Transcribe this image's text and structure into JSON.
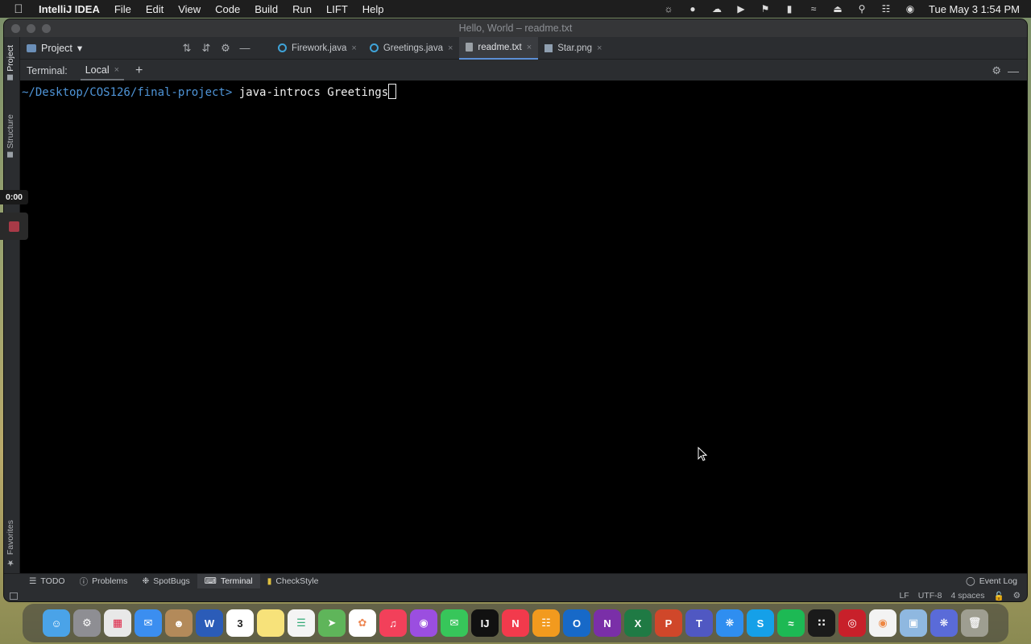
{
  "menubar": {
    "app_name": "IntelliJ IDEA",
    "items": [
      "File",
      "Edit",
      "View",
      "Code",
      "Build",
      "Run",
      "LIFT",
      "Help"
    ],
    "clock": "Tue May 3  1:54 PM"
  },
  "window": {
    "title": "Hello, World – readme.txt"
  },
  "left_strip": {
    "project_label": "Project",
    "structure_label": "Structure",
    "favorites_label": "Favorites"
  },
  "toolbar": {
    "project_selector": "Project",
    "tabs": [
      {
        "label": "Firework.java",
        "icon": "java-class-icon",
        "active": false
      },
      {
        "label": "Greetings.java",
        "icon": "java-class-icon",
        "active": false
      },
      {
        "label": "readme.txt",
        "icon": "text-file-icon",
        "active": true
      },
      {
        "label": "Star.png",
        "icon": "image-file-icon",
        "active": false
      }
    ]
  },
  "terminal": {
    "header_label": "Terminal:",
    "session_tab": "Local",
    "prompt_path": "~/Desktop/COS126/final-project>",
    "command": " java-introcs Greetings"
  },
  "bottom_tabs": {
    "todo": "TODO",
    "problems": "Problems",
    "spotbugs": "SpotBugs",
    "terminal": "Terminal",
    "checkstyle": "CheckStyle",
    "event_log": "Event Log"
  },
  "status_bar": {
    "line_separator": "LF",
    "encoding": "UTF-8",
    "indent": "4 spaces"
  },
  "recording": {
    "timer": "0:00"
  },
  "dock": {
    "calendar_day": "3",
    "apps": [
      "finder",
      "settings",
      "launchpad",
      "mail",
      "contacts",
      "word",
      "calendar",
      "notes",
      "reminders",
      "maps",
      "photos",
      "music",
      "podcasts",
      "messages",
      "intellij",
      "news",
      "books",
      "outlook",
      "onenote",
      "excel",
      "powerpoint",
      "teams",
      "safari",
      "skype",
      "spotify",
      "grid-app",
      "record-app",
      "chrome",
      "preview",
      "settings-app",
      "trash"
    ]
  }
}
